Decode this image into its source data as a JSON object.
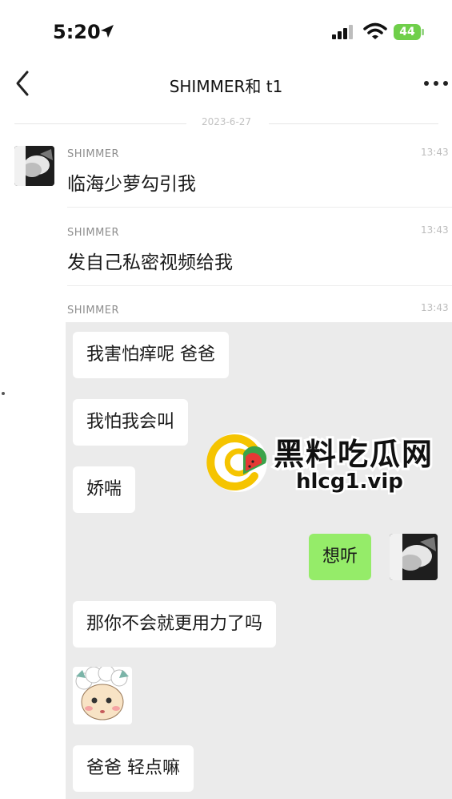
{
  "status_bar": {
    "time": "5:20",
    "battery": "44"
  },
  "nav": {
    "title": "SHIMMER和 t1"
  },
  "date_divider": "2023-6-27",
  "messages": [
    {
      "sender": "SHIMMER",
      "time": "13:43",
      "text": "临海少萝勾引我"
    },
    {
      "sender": "SHIMMER",
      "time": "13:43",
      "text": "发自己私密视频给我"
    },
    {
      "sender": "SHIMMER",
      "time": "13:43"
    }
  ],
  "screenshot_chat": {
    "bubbles": [
      {
        "side": "left",
        "text": "我害怕痒呢 爸爸"
      },
      {
        "side": "left",
        "text": "我怕我会叫"
      },
      {
        "side": "left",
        "text": "娇喘"
      },
      {
        "side": "right",
        "text": "想听"
      },
      {
        "side": "left",
        "text": "那你不会就更用力了吗"
      },
      {
        "side": "left",
        "type": "sticker",
        "icon": "sheep-sticker-icon"
      },
      {
        "side": "left",
        "text": "爸爸 轻点嘛"
      }
    ]
  },
  "watermark": {
    "name": "黑料吃瓜网",
    "url": "hlcg1.vip"
  },
  "colors": {
    "green_bubble": "#95ec69",
    "screenshot_bg": "#ebebeb",
    "logo_yellow": "#f5c400"
  }
}
